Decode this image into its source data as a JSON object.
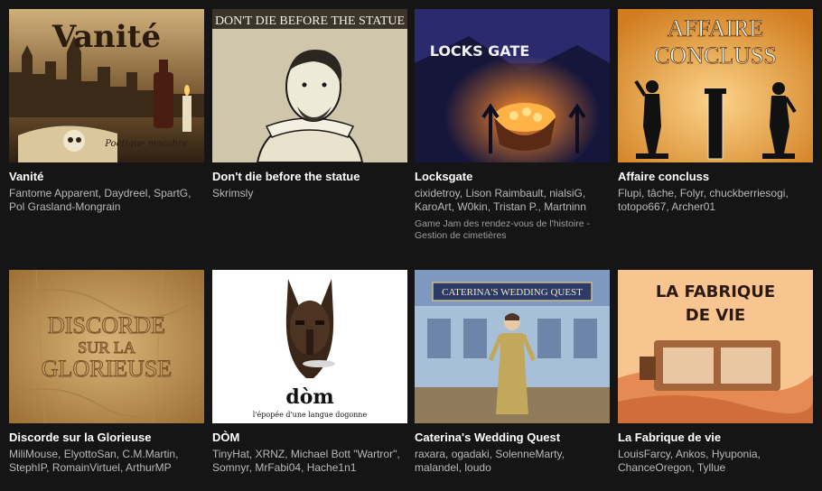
{
  "games": [
    {
      "title": "Vanité",
      "authors": [
        "Fantome Apparent",
        "Daydreel",
        "SpartG",
        "Pol Grasland-Mongrain"
      ],
      "cover": {
        "heading": "Vanité",
        "subtitle": "Poétique macabre",
        "accent": "#b58a4a"
      }
    },
    {
      "title": "Don't die before the statue",
      "authors": [
        "Skrimsly"
      ],
      "cover": {
        "heading": "DON'T DIE BEFORE THE STATUE",
        "accent": "#e9e4d4"
      }
    },
    {
      "title": "Locksgate",
      "authors": [
        "cixidetroy",
        "Lison Raimbault",
        "nialsiG",
        "KaroArt",
        "W0kin",
        "Tristan P.",
        "Martninn"
      ],
      "jam": "Game Jam des rendez-vous de l'histoire - Gestion de cimetières",
      "cover": {
        "heading": "LOCKS GATE",
        "accent": "#2c2a6e"
      }
    },
    {
      "title": "Affaire concluss",
      "authors": [
        "Flupi",
        "tâche",
        "Folyr",
        "chuckberriesogi",
        "totopo667",
        "Archer01"
      ],
      "cover": {
        "heading": "AFFAIRE CONCLUSS",
        "accent": "#e8a445"
      }
    },
    {
      "title": "Discorde sur la Glorieuse",
      "authors": [
        "MiliMouse",
        "ElyottoSan",
        "C.M.Martin",
        "StephIP",
        "RomainVirtuel",
        "ArthurMP"
      ],
      "cover": {
        "heading": "DISCORDE SUR LA GLORIEUSE",
        "accent": "#c9a367"
      }
    },
    {
      "title": "DÒM",
      "authors": [
        "TinyHat",
        "XRNZ",
        "Michael Bott \"Wartror\"",
        "Somnyr",
        "MrFabi04",
        "Hache1n1"
      ],
      "cover": {
        "heading": "dòm",
        "subtitle": "l'épopée d'une langue dogonne",
        "accent": "#ffffff"
      }
    },
    {
      "title": "Caterina's Wedding Quest",
      "authors": [
        "raxara",
        "ogadaki",
        "SolenneMarty",
        "malandel",
        "loudo"
      ],
      "cover": {
        "heading": "CATERINA'S WEDDING QUEST",
        "accent": "#8ea4c9"
      }
    },
    {
      "title": "La Fabrique de vie",
      "authors": [
        "LouisFarcy",
        "Ankos",
        "Hyuponia",
        "ChanceOregon",
        "Tyllue"
      ],
      "cover": {
        "heading": "LA FABRIQUE DE VIE",
        "accent": "#f3b27a"
      }
    }
  ]
}
